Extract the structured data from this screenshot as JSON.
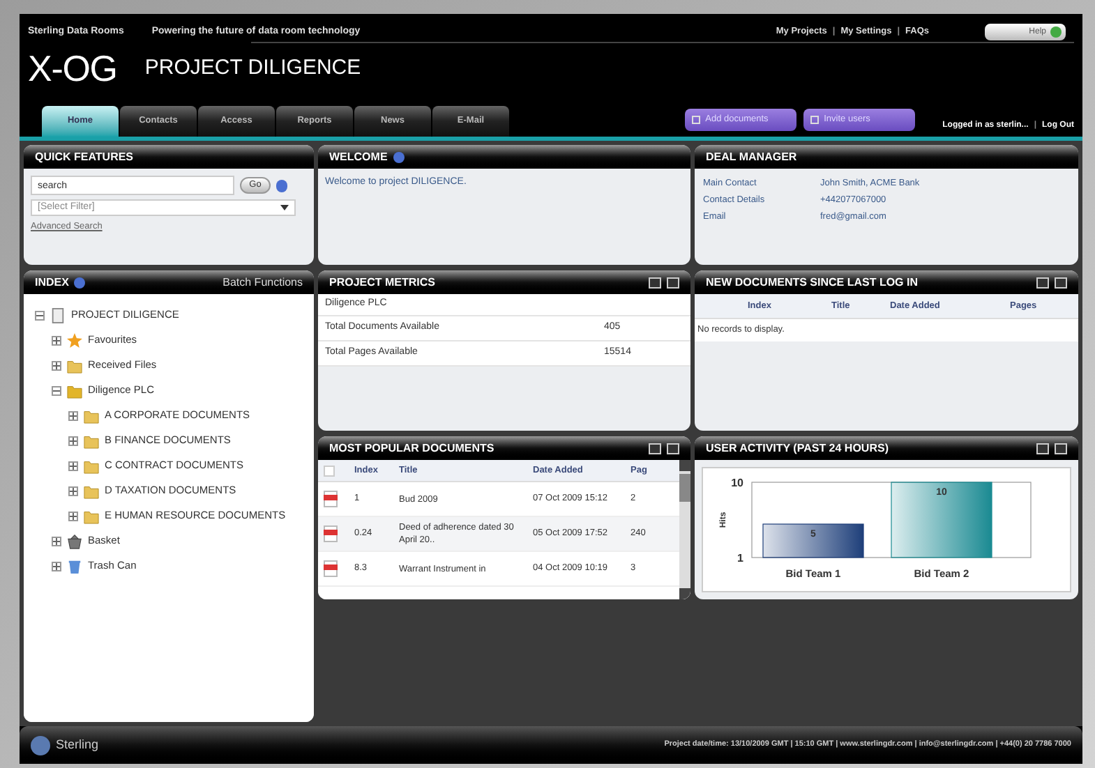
{
  "header": {
    "brand": "Sterling Data Rooms",
    "tagline": "Powering the future of data room technology",
    "links": [
      "My Projects",
      "My Settings",
      "FAQs"
    ],
    "separator": "|",
    "help": "Help",
    "logo": "X-OG",
    "project": "PROJECT DILIGENCE"
  },
  "tabs": [
    {
      "label": "Home",
      "selected": true
    },
    {
      "label": "Contacts",
      "selected": false
    },
    {
      "label": "Access",
      "selected": false
    },
    {
      "label": "Reports",
      "selected": false
    },
    {
      "label": "News",
      "selected": false
    },
    {
      "label": "E-Mail",
      "selected": false
    }
  ],
  "actions": [
    "Add documents",
    "Invite users"
  ],
  "session": {
    "user": "Logged in as sterlin...",
    "logout": "Log Out",
    "separator": "|"
  },
  "quick_features": {
    "title": "QUICK FEATURES",
    "search": {
      "value": "search"
    },
    "go": "Go",
    "filter": {
      "value": "[Select Filter]"
    },
    "advanced": "Advanced Search"
  },
  "index": {
    "title": "INDEX",
    "batch": "Batch Functions",
    "tree": [
      {
        "label": "PROJECT DILIGENCE",
        "kind": "root",
        "expanded": true,
        "children": [
          {
            "label": "Favourites",
            "kind": "star",
            "expanded": false
          },
          {
            "label": "Received Files",
            "kind": "inbox",
            "expanded": false
          },
          {
            "label": "Diligence PLC",
            "kind": "company",
            "expanded": true,
            "children": [
              {
                "label": "A CORPORATE DOCUMENTS",
                "kind": "folder",
                "expanded": false
              },
              {
                "label": "B FINANCE DOCUMENTS",
                "kind": "folder",
                "expanded": false
              },
              {
                "label": "C CONTRACT DOCUMENTS",
                "kind": "folder",
                "expanded": false
              },
              {
                "label": "D TAXATION DOCUMENTS",
                "kind": "folder",
                "expanded": false
              },
              {
                "label": "E HUMAN RESOURCE DOCUMENTS",
                "kind": "folder",
                "expanded": false
              }
            ]
          },
          {
            "label": "Basket",
            "kind": "basket",
            "expanded": false
          },
          {
            "label": "Trash Can",
            "kind": "trash",
            "expanded": false
          }
        ]
      }
    ]
  },
  "welcome": {
    "title": "WELCOME",
    "text": "Welcome to project DILIGENCE."
  },
  "deal_manager": {
    "title": "DEAL MANAGER",
    "rows": [
      {
        "label": "Main Contact",
        "value": "John Smith, ACME Bank"
      },
      {
        "label": "Contact Details",
        "value": "+442077067000"
      },
      {
        "label": "Email",
        "value": "fred@gmail.com"
      }
    ]
  },
  "project_metrics": {
    "title": "PROJECT METRICS",
    "company": "Diligence PLC",
    "rows": [
      {
        "label": "Total Documents Available",
        "value": "405"
      },
      {
        "label": "Total Pages Available",
        "value": "15514"
      }
    ]
  },
  "new_documents": {
    "title": "NEW DOCUMENTS SINCE LAST LOG IN",
    "columns": [
      "Index",
      "Title",
      "Date Added",
      "Pages"
    ],
    "empty": "No records to display."
  },
  "popular": {
    "title": "MOST POPULAR DOCUMENTS",
    "select_all": {
      "checked": false
    },
    "columns": [
      "Index",
      "Title",
      "Date Added",
      "Pag"
    ],
    "rows": [
      {
        "index": "1",
        "title": "Bud 2009",
        "date": "07 Oct 2009 15:12",
        "pages": "2"
      },
      {
        "index": "0.24",
        "title": "Deed of adherence dated 30 April 20..",
        "date": "05 Oct 2009 17:52",
        "pages": "240"
      },
      {
        "index": "8.3",
        "title": "Warrant Instrument in",
        "date": "04 Oct 2009 10:19",
        "pages": "3"
      }
    ]
  },
  "user_activity": {
    "title": "USER ACTIVITY (PAST 24 HOURS)",
    "chart_data": {
      "type": "bar",
      "ylabel": "Hits",
      "categories": [
        "Bid Team 1",
        "Bid Team 2"
      ],
      "series": [
        {
          "color": "#1e3f7a",
          "values": [
            5,
            null
          ]
        },
        {
          "color": "#1a8a92",
          "values": [
            null,
            10
          ]
        }
      ],
      "ylim": [
        1,
        10
      ],
      "yticks": [
        1,
        10
      ],
      "data_labels": true
    }
  },
  "footer": {
    "brand": "Sterling",
    "info": "Project date/time: 13/10/2009 GMT | 15:10 GMT | www.sterlingdr.com | info@sterlingdr.com | +44(0) 20 7786 7000"
  }
}
